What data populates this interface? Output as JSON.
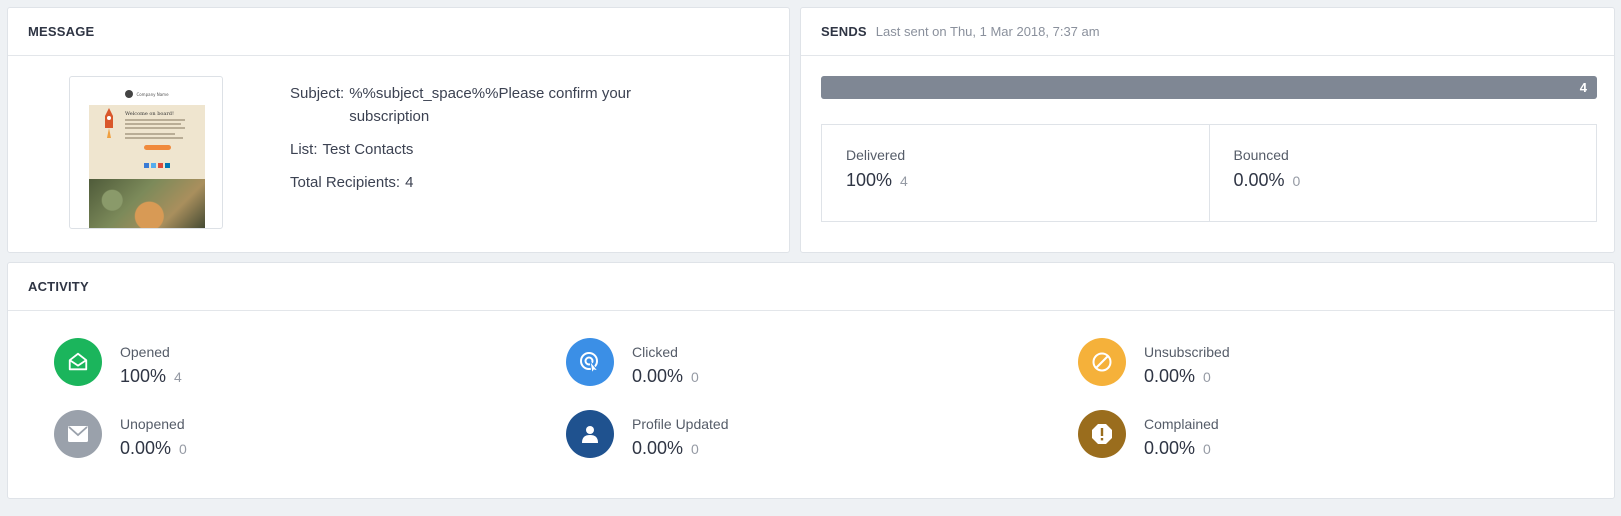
{
  "message": {
    "title": "MESSAGE",
    "thumbnail": {
      "company_name": "Company Name",
      "hero_title": "Welcome on board!"
    },
    "subject_label": "Subject:",
    "subject_value": "%%subject_space%%Please confirm your subscription",
    "list_label": "List:",
    "list_value": "Test Contacts",
    "recipients_label": "Total Recipients:",
    "recipients_value": "4"
  },
  "sends": {
    "title": "SENDS",
    "subtitle": "Last sent on Thu, 1 Mar 2018, 7:37 am",
    "progress_label": "4",
    "progress_fraction": 1.0,
    "delivered": {
      "label": "Delivered",
      "pct": "100%",
      "count": "4"
    },
    "bounced": {
      "label": "Bounced",
      "pct": "0.00%",
      "count": "0"
    }
  },
  "activity": {
    "title": "ACTIVITY",
    "items": {
      "opened": {
        "label": "Opened",
        "pct": "100%",
        "count": "4",
        "color": "#1bb55c",
        "icon": "envelope-open-icon"
      },
      "unopened": {
        "label": "Unopened",
        "pct": "0.00%",
        "count": "0",
        "color": "#9aa1ab",
        "icon": "envelope-icon"
      },
      "clicked": {
        "label": "Clicked",
        "pct": "0.00%",
        "count": "0",
        "color": "#3b8fe6",
        "icon": "cursor-click-icon"
      },
      "profile_updated": {
        "label": "Profile Updated",
        "pct": "0.00%",
        "count": "0",
        "color": "#1f528f",
        "icon": "user-icon"
      },
      "unsubscribed": {
        "label": "Unsubscribed",
        "pct": "0.00%",
        "count": "0",
        "color": "#f5b13a",
        "icon": "block-icon"
      },
      "complained": {
        "label": "Complained",
        "pct": "0.00%",
        "count": "0",
        "color": "#9a6d1d",
        "icon": "alert-octagon-icon"
      }
    }
  }
}
